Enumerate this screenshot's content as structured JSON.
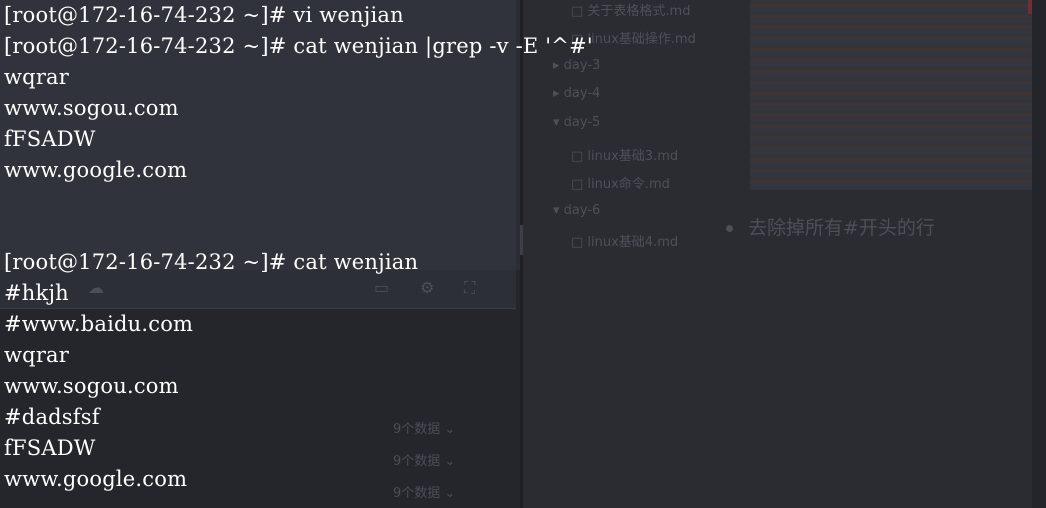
{
  "terminal": {
    "lines": [
      "[root@172-16-74-232 ~]# vi wenjian",
      "[root@172-16-74-232 ~]# cat wenjian |grep -v -E '^#'",
      "wqrar",
      "www.sogou.com",
      "fFSADW",
      "www.google.com",
      "",
      "[root@172-16-74-232 ~]# cat wenjian",
      "#hkjh",
      "#www.baidu.com",
      "wqrar",
      "www.sogou.com",
      "#dadsfsf",
      "fFSADW",
      "www.google.com"
    ]
  },
  "background": {
    "tree_items": [
      "□ 关于表格格式.md",
      "□ linux基础操作.md",
      "▸ day-3",
      "▸ day-4",
      "▾ day-5",
      "□ linux基础3.md",
      "□ linux命令.md",
      "▾ day-6",
      "□ linux基础4.md"
    ],
    "bullet_text": "去除掉所有#开头的行",
    "dropdowns": [
      "9个数据 ⌄",
      "9个数据 ⌄",
      "9个数据 ⌄"
    ],
    "media_icons": [
      "cloud-icon",
      "screen-icon",
      "gear-icon",
      "fullscreen-icon"
    ]
  }
}
